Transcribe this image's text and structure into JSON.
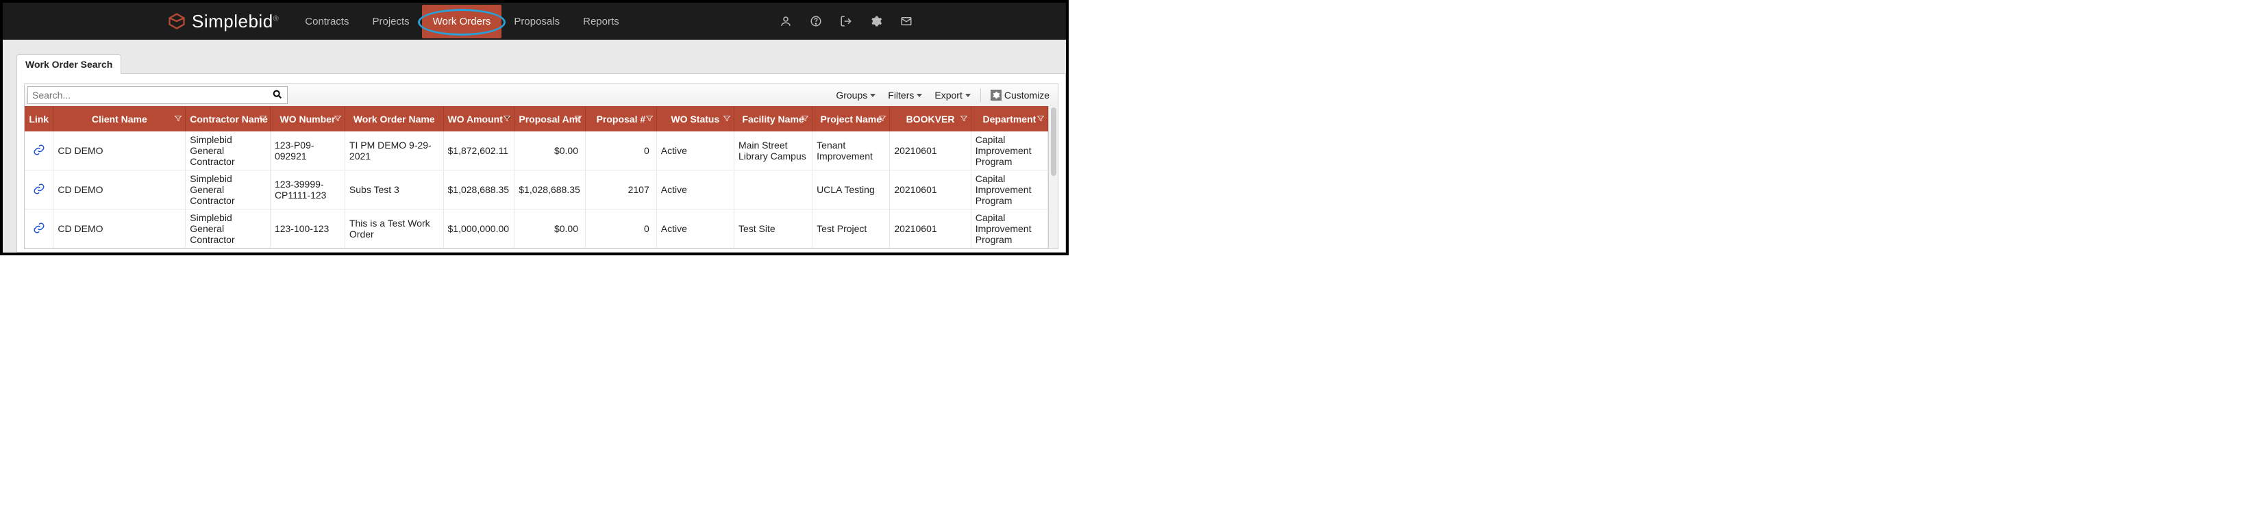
{
  "brand": {
    "name": "Simplebid",
    "reg": "®"
  },
  "nav": {
    "items": [
      {
        "label": "Contracts",
        "active": false
      },
      {
        "label": "Projects",
        "active": false
      },
      {
        "label": "Work Orders",
        "active": true
      },
      {
        "label": "Proposals",
        "active": false
      },
      {
        "label": "Reports",
        "active": false
      }
    ]
  },
  "tab": {
    "label": "Work Order Search"
  },
  "toolbar": {
    "search_placeholder": "Search...",
    "groups": "Groups",
    "filters": "Filters",
    "export": "Export",
    "customize": "Customize"
  },
  "columns": [
    {
      "key": "link",
      "label": "Link",
      "width": 40,
      "filter": false,
      "sort": null
    },
    {
      "key": "client",
      "label": "Client Name",
      "width": 184,
      "filter": true,
      "sort": null
    },
    {
      "key": "contractor",
      "label": "Contractor Name",
      "width": 118,
      "filter": true,
      "sort": null
    },
    {
      "key": "wonum",
      "label": "WO Number",
      "width": 104,
      "filter": true,
      "sort": null
    },
    {
      "key": "woname",
      "label": "Work Order Name",
      "width": 137,
      "filter": false,
      "sort": null
    },
    {
      "key": "woamount",
      "label": "WO Amount",
      "width": 99,
      "filter": true,
      "sort": "desc"
    },
    {
      "key": "propamt",
      "label": "Proposal Amt",
      "width": 99,
      "filter": true,
      "sort": null
    },
    {
      "key": "propnum",
      "label": "Proposal #",
      "width": 99,
      "filter": true,
      "sort": null
    },
    {
      "key": "status",
      "label": "WO Status",
      "width": 108,
      "filter": true,
      "sort": null
    },
    {
      "key": "facility",
      "label": "Facility Name",
      "width": 109,
      "filter": true,
      "sort": null
    },
    {
      "key": "project",
      "label": "Project Name",
      "width": 108,
      "filter": true,
      "sort": null
    },
    {
      "key": "bookver",
      "label": "BOOKVER",
      "width": 113,
      "filter": true,
      "sort": null
    },
    {
      "key": "dept",
      "label": "Department",
      "width": 107,
      "filter": true,
      "sort": null
    }
  ],
  "rows": [
    {
      "client": "CD DEMO",
      "contractor": "Simplebid General Contractor",
      "wonum": "123-P09-092921",
      "woname": "TI PM DEMO 9-29-2021",
      "woamount": "$1,872,602.11",
      "propamt": "$0.00",
      "propnum": "0",
      "status": "Active",
      "facility": "Main Street Library Campus",
      "project": "Tenant Improvement",
      "bookver": "20210601",
      "dept": "Capital Improvement Program"
    },
    {
      "client": "CD DEMO",
      "contractor": "Simplebid General Contractor",
      "wonum": "123-39999-CP1111-123",
      "woname": "Subs Test 3",
      "woamount": "$1,028,688.35",
      "propamt": "$1,028,688.35",
      "propnum": "2107",
      "status": "Active",
      "facility": "",
      "project": "UCLA Testing",
      "bookver": "20210601",
      "dept": "Capital Improvement Program"
    },
    {
      "client": "CD DEMO",
      "contractor": "Simplebid General Contractor",
      "wonum": "123-100-123",
      "woname": "This is a Test Work Order",
      "woamount": "$1,000,000.00",
      "propamt": "$0.00",
      "propnum": "0",
      "status": "Active",
      "facility": "Test Site",
      "project": "Test Project",
      "bookver": "20210601",
      "dept": "Capital Improvement Program"
    }
  ]
}
